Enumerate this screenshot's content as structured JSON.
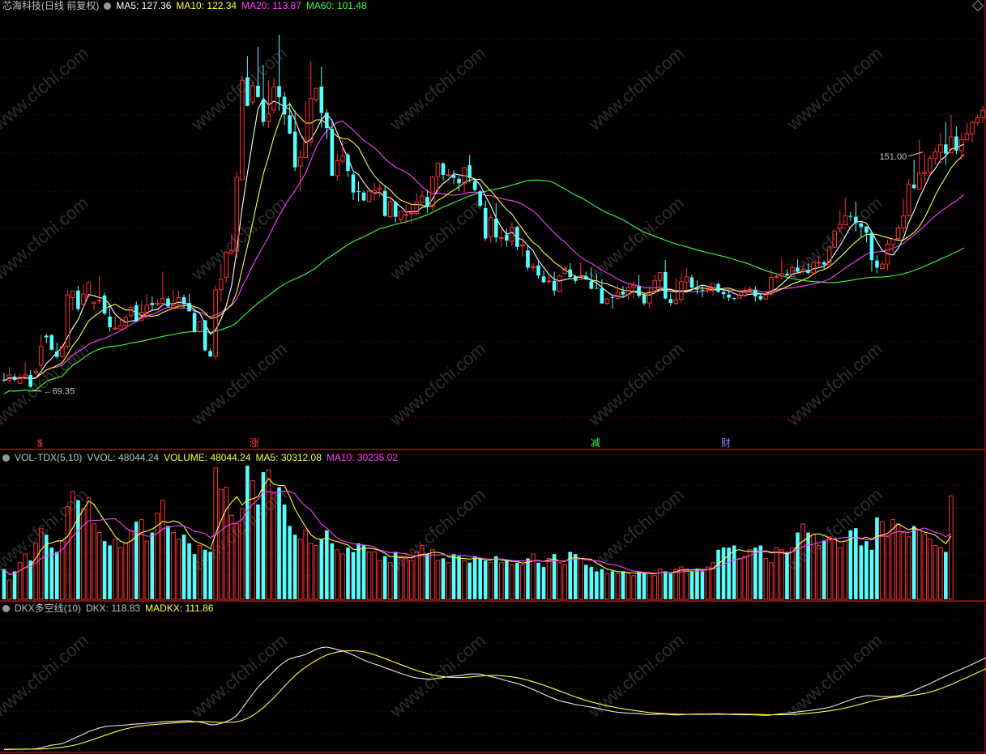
{
  "main_header": {
    "title": "芯海科技(日线 前复权)",
    "ma5": "MA5: 127.36",
    "ma10": "MA10: 122.34",
    "ma20": "MA20: 113.87",
    "ma60": "MA60: 101.48"
  },
  "vol_header": {
    "name": "VOL-TDX(5,10)",
    "vvol": "VVOL: 48044.24",
    "volume": "VOLUME: 48044.24",
    "ma5": "MA5: 30312.08",
    "ma10": "MA10: 30235.02"
  },
  "dkx_header": {
    "name": "DKX多空线(10)",
    "dkx": "DKX: 118.83",
    "madkx": "MADKX: 111.86"
  },
  "markers": [
    {
      "text": "$",
      "color": "#ff4040"
    },
    {
      "text": "涨",
      "color": "#ff4040"
    },
    {
      "text": "减",
      "color": "#40ff40"
    },
    {
      "text": "财",
      "color": "#8080ff"
    }
  ],
  "watermark": "www.cfchi.com",
  "colors": {
    "up": "#ff3030",
    "down": "#54ffff",
    "ma5": "#ffffff",
    "ma10": "#ffff40",
    "ma20": "#ff40ff",
    "ma60": "#40ff40",
    "grid": "#7a1010"
  },
  "chart_data": {
    "type": "candlestick",
    "price_axis": {
      "ymin": 60,
      "ymax": 155
    },
    "annotations": [
      {
        "text": "151.00",
        "series": "high",
        "index": 174
      },
      {
        "text": "69.35",
        "series": "low",
        "index": 5
      }
    ],
    "candles": [
      [
        71.2,
        71,
        72.8,
        70.7
      ],
      [
        71,
        72.3,
        74.1,
        70.6
      ],
      [
        71.9,
        71.2,
        72.6,
        70.8
      ],
      [
        70.4,
        71.8,
        72.5,
        70.3
      ],
      [
        71.5,
        72.3,
        75.2,
        71.3
      ],
      [
        72.3,
        69.6,
        73.4,
        69.4
      ],
      [
        72.8,
        73.1,
        73.8,
        72.3
      ],
      [
        74.5,
        78.7,
        81.3,
        73.6
      ],
      [
        81.2,
        80.8,
        81.6,
        79.4
      ],
      [
        81.3,
        78,
        81.6,
        77.9
      ],
      [
        77.6,
        76.4,
        79.6,
        75.9
      ],
      [
        76.5,
        78.8,
        79.3,
        76.2
      ],
      [
        78.8,
        90.4,
        91.5,
        78.3
      ],
      [
        89.8,
        91.3,
        91.3,
        86.9
      ],
      [
        91.4,
        87.2,
        92.5,
        86.7
      ],
      [
        88.3,
        90.6,
        92.7,
        87.5
      ],
      [
        90.2,
        93.2,
        93.4,
        89.8
      ],
      [
        88.5,
        88.8,
        88.8,
        87
      ],
      [
        89.1,
        89.2,
        94.6,
        88.4
      ],
      [
        90.3,
        86.2,
        90.9,
        85.8
      ],
      [
        85.5,
        83.1,
        88.5,
        82.1
      ],
      [
        82.9,
        82.9,
        85.6,
        82.5
      ],
      [
        82.7,
        83.5,
        85.4,
        82.6
      ],
      [
        83.5,
        85.3,
        85.8,
        82.7
      ],
      [
        85.7,
        87.6,
        88.1,
        85.2
      ],
      [
        88.1,
        84.4,
        88.9,
        84.2
      ],
      [
        84.6,
        86.5,
        89.1,
        84.5
      ],
      [
        85.8,
        88.1,
        90.5,
        84.9
      ],
      [
        88.6,
        88.1,
        90,
        86.8
      ],
      [
        88.3,
        88.5,
        89.5,
        87.9
      ],
      [
        88.5,
        89.6,
        95.7,
        88
      ],
      [
        89.6,
        87.8,
        90.1,
        87.6
      ],
      [
        87.3,
        88.1,
        91.5,
        87.2
      ],
      [
        88.3,
        89.8,
        91.4,
        87.9
      ],
      [
        89.9,
        88.3,
        90.5,
        87.6
      ],
      [
        88.6,
        86.7,
        90.7,
        86.7
      ],
      [
        86.3,
        82.1,
        87.4,
        81.9
      ],
      [
        82.1,
        84.4,
        84.5,
        81.8
      ],
      [
        84.7,
        77.9,
        84.7,
        77.7
      ],
      [
        77.7,
        76.5,
        78.3,
        76.3
      ],
      [
        76.5,
        91.5,
        92.6,
        75.8
      ],
      [
        91.6,
        94,
        97.5,
        88.9
      ],
      [
        94.4,
        100.1,
        100.3,
        93.2
      ],
      [
        99.9,
        100.4,
        104.3,
        99.5
      ],
      [
        100.3,
        117,
        118.4,
        98.6
      ],
      [
        116.5,
        139,
        140,
        116.4
      ],
      [
        139.7,
        133.2,
        144.5,
        133.1
      ],
      [
        134.1,
        137.8,
        138.7,
        133.4
      ],
      [
        137.8,
        135.2,
        146.6,
        135.1
      ],
      [
        134.6,
        129.6,
        142.5,
        128.6
      ],
      [
        129.7,
        131.4,
        139,
        128.3
      ],
      [
        132.3,
        137.5,
        139.5,
        131.5
      ],
      [
        137.7,
        135.2,
        149.3,
        132.1
      ],
      [
        135.3,
        131.3,
        136.3,
        128.9
      ],
      [
        131.1,
        126.9,
        134,
        126.9
      ],
      [
        127.4,
        119.3,
        132.2,
        118.5
      ],
      [
        119.6,
        121.6,
        123.2,
        114.1
      ],
      [
        121.5,
        125.3,
        134.3,
        121.5
      ],
      [
        125.1,
        134.9,
        143.4,
        124.1
      ],
      [
        134.6,
        137.2,
        137.2,
        134
      ],
      [
        137.6,
        131.6,
        142.1,
        128.3
      ],
      [
        131.7,
        128.2,
        132.4,
        125.7
      ],
      [
        128,
        117.4,
        130.2,
        117.3
      ],
      [
        117.4,
        120.8,
        122.4,
        116.3
      ],
      [
        120.7,
        121.9,
        125.4,
        120.1
      ],
      [
        122.2,
        118.5,
        122.6,
        117.2
      ],
      [
        117.7,
        113.6,
        118.2,
        111.9
      ],
      [
        113.9,
        113.7,
        116.1,
        111.6
      ],
      [
        113.6,
        111.8,
        114,
        111.6
      ],
      [
        111.5,
        113.9,
        114.1,
        111.4
      ],
      [
        113.6,
        114.1,
        115.9,
        111.8
      ],
      [
        114.3,
        114.6,
        115.6,
        112.7
      ],
      [
        114,
        108.3,
        115.2,
        108.1
      ],
      [
        108.1,
        111.5,
        112.8,
        107.9
      ],
      [
        111.4,
        108.1,
        111.7,
        106.8
      ],
      [
        107.5,
        109.3,
        109.3,
        106.9
      ],
      [
        108.6,
        108.6,
        110.8,
        106.6
      ],
      [
        108.9,
        109,
        111,
        106.5
      ],
      [
        108.9,
        111.4,
        113.4,
        108.4
      ],
      [
        111.4,
        112.8,
        114,
        111.1
      ],
      [
        112.6,
        110.4,
        114.2,
        109
      ],
      [
        110.4,
        117.1,
        117.4,
        109.5
      ],
      [
        117.2,
        120.2,
        120.4,
        113.5
      ],
      [
        120.2,
        117.6,
        120.5,
        116.4
      ],
      [
        117.5,
        117.6,
        118.9,
        117.4
      ],
      [
        117.6,
        116.9,
        118.6,
        115.5
      ],
      [
        116.7,
        115.7,
        117.2,
        113.9
      ],
      [
        115.6,
        119.2,
        119.3,
        113.3
      ],
      [
        119.8,
        116.9,
        122.1,
        115.9
      ],
      [
        116.2,
        114.2,
        117,
        113.8
      ],
      [
        113.9,
        110.6,
        114.2,
        110.3
      ],
      [
        110.1,
        103.2,
        111.8,
        102.7
      ],
      [
        103.6,
        107.9,
        108.8,
        102.2
      ],
      [
        107.7,
        103.4,
        111.2,
        102.3
      ],
      [
        103.4,
        103.4,
        105.2,
        101.2
      ],
      [
        104,
        102.7,
        105.4,
        101.3
      ],
      [
        102.6,
        105.7,
        106.9,
        101.5
      ],
      [
        105.8,
        101.3,
        106.1,
        100.6
      ],
      [
        101.6,
        101.7,
        103.6,
        99.1
      ],
      [
        100.5,
        96.6,
        101.6,
        96
      ],
      [
        96.6,
        96.8,
        97.6,
        95.8
      ],
      [
        97.1,
        94.8,
        98,
        94.1
      ],
      [
        94.6,
        93.3,
        95.9,
        93
      ],
      [
        93.4,
        93.6,
        94.8,
        92.9
      ],
      [
        93.6,
        91.4,
        95.7,
        90.2
      ],
      [
        91.2,
        94.7,
        95.1,
        91.1
      ],
      [
        95.3,
        96.4,
        96.8,
        94.9
      ],
      [
        96.2,
        94.5,
        97.6,
        94.3
      ],
      [
        94.6,
        93.6,
        95,
        93
      ],
      [
        93.9,
        94.6,
        97.9,
        93.9
      ],
      [
        94.7,
        93.9,
        95.7,
        93.8
      ],
      [
        93.5,
        91.8,
        96.6,
        91.7
      ],
      [
        92,
        91.9,
        95.3,
        91.9
      ],
      [
        91.9,
        88.5,
        93.9,
        88.4
      ],
      [
        88.5,
        89.5,
        89.7,
        88.2
      ],
      [
        89.9,
        89.8,
        90.2,
        87.3
      ],
      [
        89.6,
        91,
        92.7,
        89.5
      ],
      [
        91.2,
        90.5,
        92.4,
        89.9
      ],
      [
        90.5,
        92.1,
        92.8,
        89.2
      ],
      [
        92.1,
        92.6,
        93.5,
        89.6
      ],
      [
        92.4,
        90.2,
        95,
        89.7
      ],
      [
        90.4,
        88.5,
        90.7,
        88
      ],
      [
        88.6,
        91.1,
        92.4,
        87.4
      ],
      [
        91.1,
        93.7,
        95,
        90.7
      ],
      [
        93.7,
        95.5,
        95.6,
        91.2
      ],
      [
        95.6,
        89.6,
        98.3,
        89.4
      ],
      [
        89.5,
        88.6,
        90.8,
        87.9
      ],
      [
        88.5,
        89.3,
        94.2,
        88.2
      ],
      [
        89.4,
        93.4,
        95.2,
        88.7
      ],
      [
        93.3,
        94.5,
        96.5,
        91.4
      ],
      [
        94.4,
        92.1,
        95,
        91.6
      ],
      [
        91.8,
        91.7,
        93.7,
        90.6
      ],
      [
        91.6,
        91.5,
        92.6,
        89.9
      ],
      [
        91.6,
        91.9,
        92,
        90.8
      ],
      [
        91.9,
        93,
        93,
        90.3
      ],
      [
        92.9,
        91.1,
        93.3,
        90.9
      ],
      [
        91.1,
        90.6,
        91.6,
        89.5
      ],
      [
        90.5,
        89.8,
        91.4,
        89
      ],
      [
        89.7,
        89.5,
        89.8,
        89.2
      ],
      [
        89.7,
        90.4,
        91.5,
        89.6
      ],
      [
        90.3,
        91.5,
        92.3,
        89.9
      ],
      [
        91.4,
        91.7,
        92.4,
        91.1
      ],
      [
        91.6,
        90.1,
        92.4,
        88.9
      ],
      [
        90.2,
        89.4,
        90.7,
        89.1
      ],
      [
        89.5,
        90.7,
        91.4,
        89.3
      ],
      [
        90.6,
        94.4,
        96.2,
        90.1
      ],
      [
        94.4,
        94.6,
        95.1,
        94.1
      ],
      [
        94.7,
        95.3,
        98.6,
        93.9
      ],
      [
        95.2,
        94.8,
        96.2,
        94.7
      ],
      [
        94.6,
        96.6,
        97.3,
        94.6
      ],
      [
        96.6,
        95.7,
        98.5,
        95.5
      ],
      [
        95.8,
        96.2,
        97.2,
        95.1
      ],
      [
        96.1,
        95.4,
        97.5,
        95
      ],
      [
        95.4,
        97.8,
        97.9,
        94.9
      ],
      [
        97.7,
        97.8,
        99.2,
        96.8
      ],
      [
        97.8,
        97.3,
        98.2,
        96.3
      ],
      [
        97.2,
        101.3,
        101.6,
        97
      ],
      [
        101.2,
        104.9,
        105.2,
        101.2
      ],
      [
        105.5,
        106.4,
        109.7,
        104.5
      ],
      [
        106.3,
        108.3,
        112.4,
        106.3
      ],
      [
        108.3,
        108.1,
        109.2,
        107.2
      ],
      [
        108.1,
        106.8,
        111.5,
        104.8
      ],
      [
        106.6,
        105.8,
        106.9,
        103.6
      ],
      [
        105.9,
        104.5,
        106,
        102.3
      ],
      [
        104.5,
        98.3,
        104.6,
        95.7
      ],
      [
        98.2,
        96.6,
        99.4,
        95.3
      ],
      [
        96.4,
        97.4,
        98.1,
        96.2
      ],
      [
        97.4,
        101.9,
        103,
        96
      ],
      [
        101.8,
        103,
        103.2,
        100
      ],
      [
        103.2,
        105.6,
        106.2,
        103
      ],
      [
        105.6,
        108.3,
        112.2,
        104.5
      ],
      [
        108.4,
        115.4,
        116.7,
        108.2
      ],
      [
        115.4,
        114.6,
        121,
        114.3
      ],
      [
        114.4,
        117.9,
        125.6,
        114.1
      ],
      [
        117.9,
        118.2,
        122.4,
        115.7
      ],
      [
        118.2,
        121.4,
        122.1,
        117.3
      ],
      [
        121.3,
        122.8,
        123.6,
        119.9
      ],
      [
        122.7,
        124.4,
        127.1,
        120.2
      ],
      [
        124.5,
        122.4,
        129.6,
        119.9
      ],
      [
        122.6,
        126.2,
        131.2,
        122.5
      ],
      [
        126.3,
        123.1,
        128.5,
        122.3
      ],
      [
        123.1,
        125.6,
        127.2,
        121.1
      ],
      [
        125.5,
        126.9,
        129.3,
        125.4
      ],
      [
        126.9,
        129.5,
        129.7,
        124.9
      ],
      [
        129.4,
        130.5,
        131.2,
        128.8
      ],
      [
        130.5,
        132.2,
        133.2,
        129.4
      ],
      [
        132,
        130.5,
        136.8,
        129.8
      ],
      [
        130.7,
        132.5,
        135.4,
        129.1
      ],
      [
        132.5,
        139.5,
        141.4,
        131.1
      ],
      [
        139.3,
        143.4,
        151,
        138.8
      ]
    ],
    "volume": [
      14000,
      9000,
      13000,
      17000,
      21000,
      18000,
      26000,
      33000,
      30000,
      24000,
      22000,
      27000,
      43000,
      50000,
      46000,
      42000,
      47000,
      35000,
      31000,
      27000,
      25000,
      28000,
      24000,
      26000,
      32000,
      36000,
      37000,
      27000,
      31000,
      40000,
      46000,
      34000,
      31000,
      28000,
      30000,
      26000,
      21000,
      25000,
      23000,
      22000,
      61000,
      51000,
      52000,
      39000,
      35000,
      42000,
      62000,
      55000,
      44000,
      59000,
      60000,
      49000,
      52000,
      44000,
      34000,
      30000,
      28000,
      32000,
      26000,
      25000,
      28000,
      32000,
      26000,
      23000,
      21000,
      24000,
      22000,
      26000,
      25000,
      22000,
      22000,
      18000,
      20000,
      17000,
      22000,
      20000,
      19000,
      18000,
      22000,
      25000,
      21000,
      23000,
      18000,
      19000,
      17000,
      21000,
      20000,
      18000,
      17000,
      20000,
      19000,
      18000,
      17000,
      20000,
      17000,
      18000,
      16000,
      17000,
      16000,
      19000,
      21000,
      17000,
      15000,
      19000,
      21000,
      17000,
      16000,
      22000,
      21000,
      19000,
      16000,
      15000,
      13000,
      14000,
      12000,
      13000,
      12000,
      13000,
      12000,
      11000,
      13000,
      12000,
      12000,
      11000,
      14000,
      13000,
      12000,
      14000,
      15000,
      14000,
      13000,
      14000,
      13000,
      15000,
      17000,
      23000,
      24000,
      24000,
      25000,
      19000,
      20000,
      23000,
      24000,
      25000,
      19000,
      17000,
      24000,
      23000,
      22000,
      24000,
      31000,
      35000,
      31000,
      30000,
      25000,
      27000,
      29000,
      28000,
      24000,
      27000,
      32000,
      33000,
      25000,
      27000,
      23000,
      38000,
      36000,
      29000,
      37000,
      35000,
      31000,
      29000,
      34000,
      32000,
      30000,
      28000,
      25000,
      24000,
      22000,
      48000
    ],
    "dkx_axis": {
      "ymin": 70,
      "ymax": 150
    }
  }
}
